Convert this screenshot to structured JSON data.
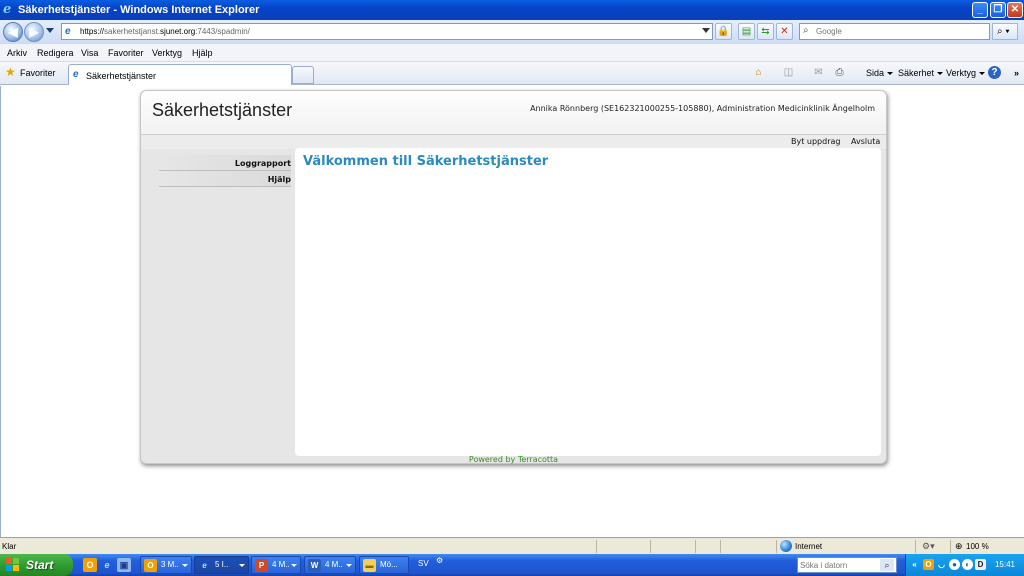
{
  "window": {
    "title": "Säkerhetstjänster - Windows Internet Explorer",
    "minimize": "_",
    "maximize": "❐",
    "close": "✕"
  },
  "address": {
    "url_prefix": "https://",
    "url_host_pre": "sakerhetstjanst.",
    "url_domain": "sjunet.org",
    "url_rest": ":7443/spadmin/",
    "search_placeholder": "Google"
  },
  "menu": {
    "items": [
      "Arkiv",
      "Redigera",
      "Visa",
      "Favoriter",
      "Verktyg",
      "Hjälp"
    ]
  },
  "favorites_bar": {
    "favorites_label": "Favoriter",
    "tab_title": "Säkerhetstjänster",
    "commands": [
      "Sida",
      "Säkerhet",
      "Verktyg"
    ]
  },
  "site": {
    "title": "Säkerhetstjänster",
    "user_info": "Annika Rönnberg (SE162321000255-105880), Administration Medicinklinik Ängelholm",
    "actions": [
      "Byt uppdrag",
      "Avsluta"
    ],
    "sidebar": [
      "Loggrapport",
      "Hjälp"
    ],
    "welcome": "Välkommen till Säkerhetstjänster",
    "footer": "Powered by Terracotta"
  },
  "statusbar": {
    "status": "Klar",
    "zone": "Internet",
    "zoom": "100 %"
  },
  "taskbar": {
    "start": "Start",
    "buttons": [
      "3 M..",
      "5 I..",
      "4 M..",
      "4 M..",
      "Mö..."
    ],
    "language": "SV",
    "search_placeholder": "Söka i datorn",
    "clock": "15:41"
  }
}
